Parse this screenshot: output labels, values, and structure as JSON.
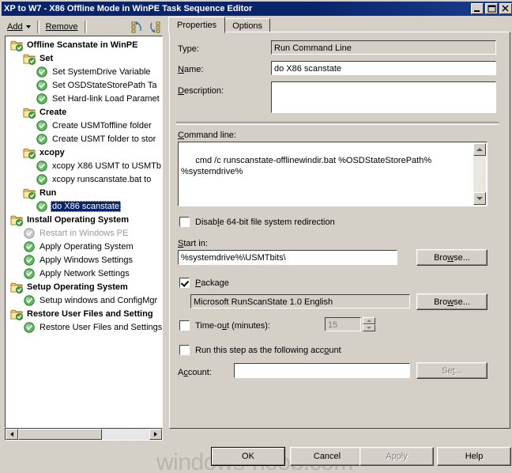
{
  "window": {
    "title": "XP to W7 - X86 Offline Mode in WinPE Task Sequence Editor",
    "minimize_label": "minimize",
    "maximize_label": "maximize",
    "close_label": "close"
  },
  "toolbar": {
    "add_label": "Add",
    "remove_label": "Remove",
    "move_up_icon": "move-up-icon",
    "move_down_icon": "move-down-icon"
  },
  "tree": {
    "nodes": [
      {
        "label": "Offline Scanstate in WinPE",
        "indent": 0,
        "type": "folder",
        "bold": true,
        "selected": false,
        "disabled": false
      },
      {
        "label": "Set",
        "indent": 1,
        "type": "folder",
        "bold": true,
        "selected": false,
        "disabled": false
      },
      {
        "label": "Set SystemDrive Variable",
        "indent": 2,
        "type": "step",
        "bold": false,
        "selected": false,
        "disabled": false
      },
      {
        "label": "Set OSDStateStorePath Ta",
        "indent": 2,
        "type": "step",
        "bold": false,
        "selected": false,
        "disabled": false
      },
      {
        "label": "Set Hard-link Load Paramet",
        "indent": 2,
        "type": "step",
        "bold": false,
        "selected": false,
        "disabled": false
      },
      {
        "label": "Create",
        "indent": 1,
        "type": "folder",
        "bold": true,
        "selected": false,
        "disabled": false
      },
      {
        "label": "Create USMToffline folder",
        "indent": 2,
        "type": "step",
        "bold": false,
        "selected": false,
        "disabled": false
      },
      {
        "label": "Create USMT folder to stor",
        "indent": 2,
        "type": "step",
        "bold": false,
        "selected": false,
        "disabled": false
      },
      {
        "label": "xcopy",
        "indent": 1,
        "type": "folder",
        "bold": true,
        "selected": false,
        "disabled": false
      },
      {
        "label": "xcopy X86 USMT to USMTb",
        "indent": 2,
        "type": "step",
        "bold": false,
        "selected": false,
        "disabled": false
      },
      {
        "label": "xcopy runscanstate.bat to",
        "indent": 2,
        "type": "step",
        "bold": false,
        "selected": false,
        "disabled": false
      },
      {
        "label": "Run",
        "indent": 1,
        "type": "folder",
        "bold": true,
        "selected": false,
        "disabled": false
      },
      {
        "label": "do X86 scanstate",
        "indent": 2,
        "type": "step",
        "bold": false,
        "selected": true,
        "disabled": false
      },
      {
        "label": "Install Operating System",
        "indent": 0,
        "type": "folder",
        "bold": true,
        "selected": false,
        "disabled": false
      },
      {
        "label": "Restart in Windows PE",
        "indent": 1,
        "type": "step",
        "bold": false,
        "selected": false,
        "disabled": true
      },
      {
        "label": "Apply Operating System",
        "indent": 1,
        "type": "step",
        "bold": false,
        "selected": false,
        "disabled": false
      },
      {
        "label": "Apply Windows Settings",
        "indent": 1,
        "type": "step",
        "bold": false,
        "selected": false,
        "disabled": false
      },
      {
        "label": "Apply Network Settings",
        "indent": 1,
        "type": "step",
        "bold": false,
        "selected": false,
        "disabled": false
      },
      {
        "label": "Setup Operating System",
        "indent": 0,
        "type": "folder",
        "bold": true,
        "selected": false,
        "disabled": false
      },
      {
        "label": "Setup windows and ConfigMgr",
        "indent": 1,
        "type": "step",
        "bold": false,
        "selected": false,
        "disabled": false
      },
      {
        "label": "Restore User Files and Setting",
        "indent": 0,
        "type": "folder",
        "bold": true,
        "selected": false,
        "disabled": false
      },
      {
        "label": "Restore User Files and Settings",
        "indent": 1,
        "type": "step",
        "bold": false,
        "selected": false,
        "disabled": false
      }
    ]
  },
  "tabs": [
    {
      "label": "Properties",
      "active": true
    },
    {
      "label": "Options",
      "active": false
    }
  ],
  "properties": {
    "type_label": "Type:",
    "type_value": "Run Command Line",
    "name_label": "Name:",
    "name_value": "do X86 scanstate",
    "description_label": "Description:",
    "description_value": "",
    "command_line_label": "Command line:",
    "command_line_value": "cmd /c runscanstate-offlinewindir.bat %OSDStateStorePath%\n%systemdrive%",
    "disable_redirection_label": "Disable 64-bit file system redirection",
    "disable_redirection_checked": false,
    "start_in_label": "Start in:",
    "start_in_value": "%systemdrive%\\USMTbits\\",
    "start_in_browse_label": "Browse...",
    "package_label": "Package",
    "package_checked": true,
    "package_value": "Microsoft RunScanState 1.0 English",
    "package_browse_label": "Browse...",
    "timeout_label": "Time-out (minutes):",
    "timeout_checked": false,
    "timeout_value": "15",
    "run_as_label": "Run this step as the following account",
    "run_as_checked": false,
    "account_label": "Account:",
    "account_value": "",
    "account_set_label": "Set..."
  },
  "footer": {
    "ok_label": "OK",
    "cancel_label": "Cancel",
    "apply_label": "Apply",
    "apply_disabled": true,
    "help_label": "Help"
  },
  "watermark": {
    "text": "windows-noob.com"
  }
}
